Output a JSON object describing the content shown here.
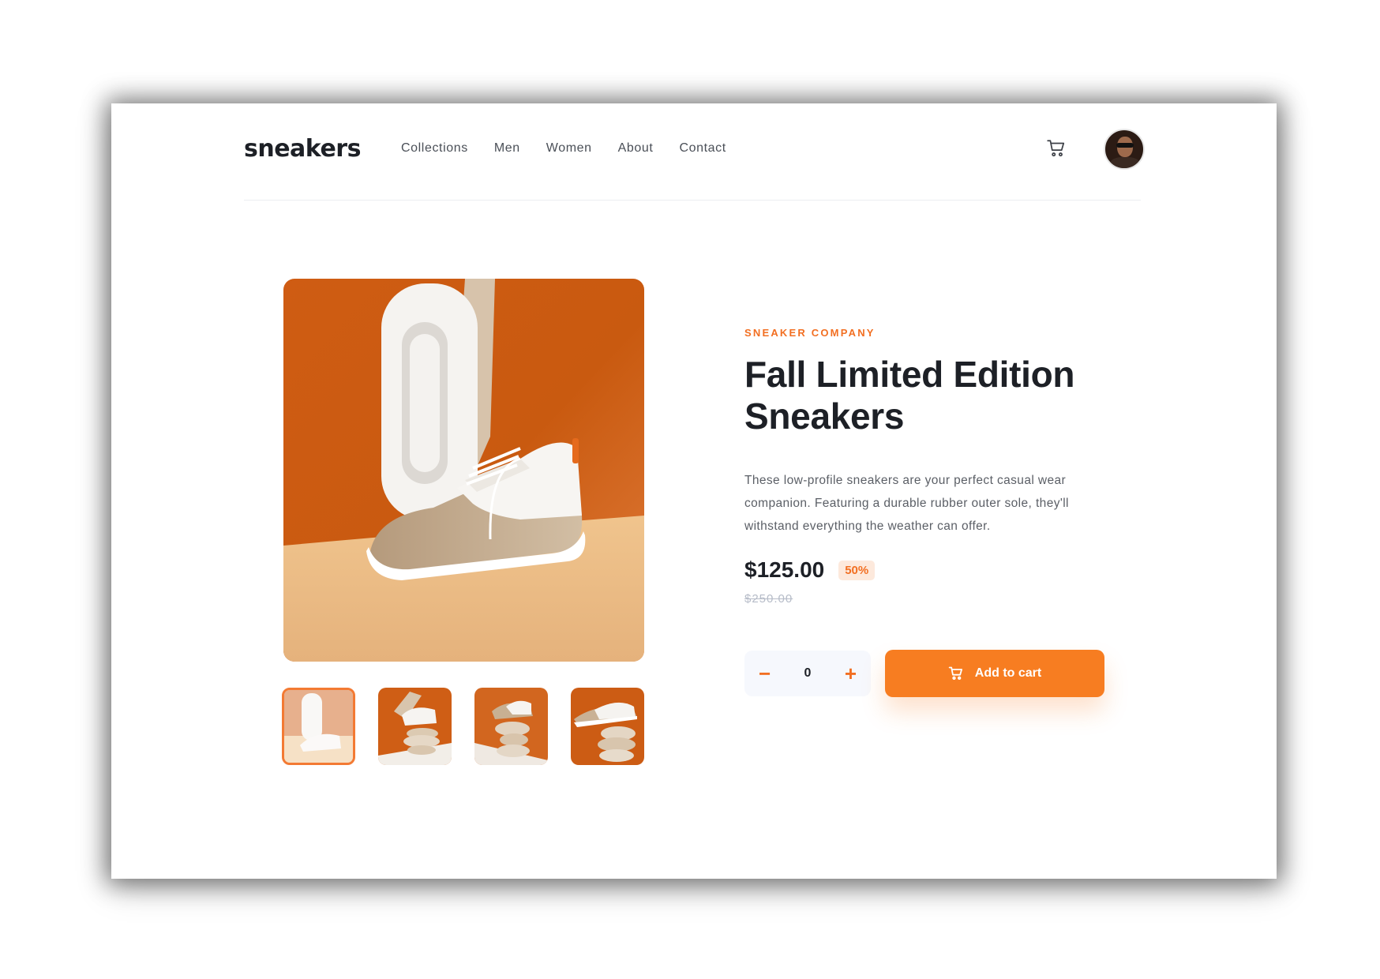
{
  "header": {
    "logo": "sneakers",
    "nav": [
      "Collections",
      "Men",
      "Women",
      "About",
      "Contact"
    ],
    "cart_icon": "cart-icon",
    "avatar_icon": "user-avatar"
  },
  "product": {
    "company": "SNEAKER COMPANY",
    "title_line1": "Fall Limited Edition",
    "title_line2": "Sneakers",
    "description": "These low-profile sneakers are your perfect casual wear companion. Featuring a durable rubber outer sole, they'll withstand everything the weather can offer.",
    "price": "$125.00",
    "discount": "50%",
    "original_price": "$250.00"
  },
  "cart": {
    "decrement": "−",
    "quantity": "0",
    "increment": "+",
    "add_label": "Add to cart"
  },
  "colors": {
    "accent": "#f26f22",
    "button": "#f77d21",
    "text": "#1d2026",
    "muted": "#5b5f66"
  }
}
